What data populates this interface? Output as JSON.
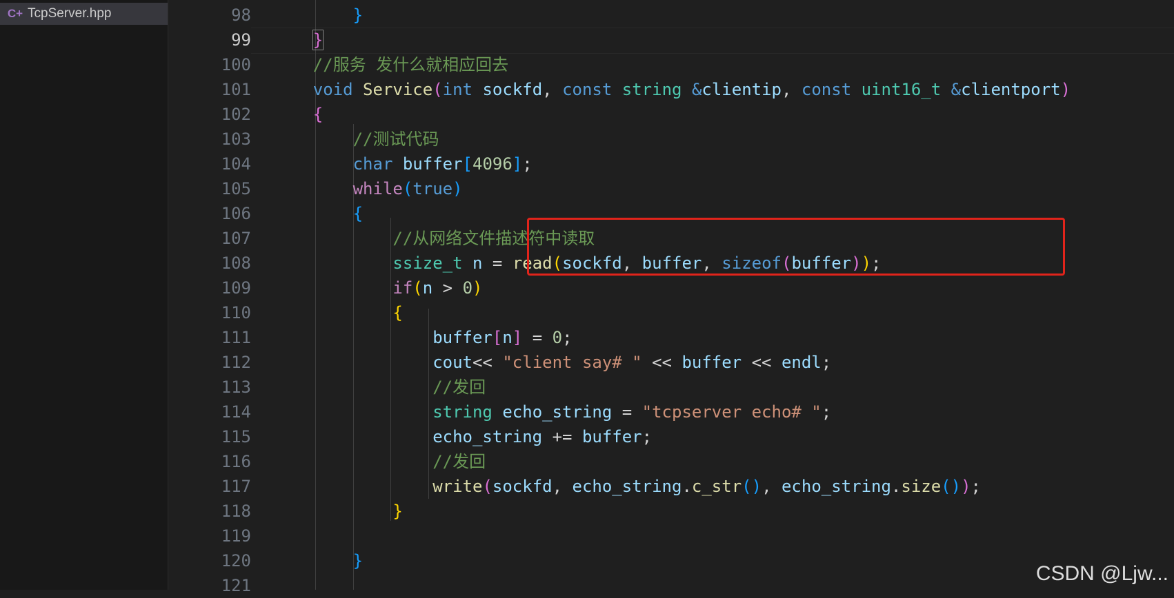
{
  "sidebar": {
    "file": {
      "name": "TcpServer.hpp",
      "icon": "cpp-header-icon",
      "icon_glyph": "C+"
    }
  },
  "editor": {
    "active_line": 99,
    "line_numbers": [
      "98",
      "99",
      "100",
      "101",
      "102",
      "103",
      "104",
      "105",
      "106",
      "107",
      "108",
      "109",
      "110",
      "111",
      "112",
      "113",
      "114",
      "115",
      "116",
      "117",
      "118",
      "119",
      "120",
      "121"
    ],
    "highlight_lines": [
      107,
      108
    ],
    "highlight_color": "#e0241b",
    "lines": [
      {
        "no": "98",
        "tokens": [
          {
            "t": "        ",
            "c": ""
          },
          {
            "t": "}",
            "c": "b3"
          }
        ]
      },
      {
        "no": "99",
        "tokens": [
          {
            "t": "    ",
            "c": ""
          },
          {
            "t": "}",
            "c": "b2"
          }
        ]
      },
      {
        "no": "100",
        "tokens": [
          {
            "t": "    ",
            "c": ""
          },
          {
            "t": "//服务 发什么就相应回去",
            "c": "cm"
          }
        ]
      },
      {
        "no": "101",
        "tokens": [
          {
            "t": "    ",
            "c": ""
          },
          {
            "t": "void",
            "c": "kw"
          },
          {
            "t": " ",
            "c": ""
          },
          {
            "t": "Service",
            "c": "fn"
          },
          {
            "t": "(",
            "c": "b2"
          },
          {
            "t": "int",
            "c": "kw"
          },
          {
            "t": " ",
            "c": ""
          },
          {
            "t": "sockfd",
            "c": "va"
          },
          {
            "t": ", ",
            "c": "op"
          },
          {
            "t": "const",
            "c": "kw"
          },
          {
            "t": " ",
            "c": ""
          },
          {
            "t": "string",
            "c": "ty"
          },
          {
            "t": " ",
            "c": ""
          },
          {
            "t": "&",
            "c": "kw"
          },
          {
            "t": "clientip",
            "c": "va"
          },
          {
            "t": ", ",
            "c": "op"
          },
          {
            "t": "const",
            "c": "kw"
          },
          {
            "t": " ",
            "c": ""
          },
          {
            "t": "uint16_t",
            "c": "ty"
          },
          {
            "t": " ",
            "c": ""
          },
          {
            "t": "&",
            "c": "kw"
          },
          {
            "t": "clientport",
            "c": "va"
          },
          {
            "t": ")",
            "c": "b2"
          }
        ]
      },
      {
        "no": "102",
        "tokens": [
          {
            "t": "    ",
            "c": ""
          },
          {
            "t": "{",
            "c": "b2"
          }
        ]
      },
      {
        "no": "103",
        "tokens": [
          {
            "t": "        ",
            "c": ""
          },
          {
            "t": "//测试代码",
            "c": "cm"
          }
        ]
      },
      {
        "no": "104",
        "tokens": [
          {
            "t": "        ",
            "c": ""
          },
          {
            "t": "char",
            "c": "kw"
          },
          {
            "t": " ",
            "c": ""
          },
          {
            "t": "buffer",
            "c": "va"
          },
          {
            "t": "[",
            "c": "b3"
          },
          {
            "t": "4096",
            "c": "nu"
          },
          {
            "t": "]",
            "c": "b3"
          },
          {
            "t": ";",
            "c": "op"
          }
        ]
      },
      {
        "no": "105",
        "tokens": [
          {
            "t": "        ",
            "c": ""
          },
          {
            "t": "while",
            "c": "ctl"
          },
          {
            "t": "(",
            "c": "b3"
          },
          {
            "t": "true",
            "c": "kw"
          },
          {
            "t": ")",
            "c": "b3"
          }
        ]
      },
      {
        "no": "106",
        "tokens": [
          {
            "t": "        ",
            "c": ""
          },
          {
            "t": "{",
            "c": "b3"
          }
        ]
      },
      {
        "no": "107",
        "tokens": [
          {
            "t": "            ",
            "c": ""
          },
          {
            "t": "//从网络文件描述符中读取",
            "c": "cm"
          }
        ]
      },
      {
        "no": "108",
        "tokens": [
          {
            "t": "            ",
            "c": ""
          },
          {
            "t": "ssize_t",
            "c": "ty"
          },
          {
            "t": " ",
            "c": ""
          },
          {
            "t": "n",
            "c": "va"
          },
          {
            "t": " = ",
            "c": "op"
          },
          {
            "t": "read",
            "c": "fn"
          },
          {
            "t": "(",
            "c": "b1"
          },
          {
            "t": "sockfd",
            "c": "va"
          },
          {
            "t": ", ",
            "c": "op"
          },
          {
            "t": "buffer",
            "c": "va"
          },
          {
            "t": ", ",
            "c": "op"
          },
          {
            "t": "sizeof",
            "c": "kw"
          },
          {
            "t": "(",
            "c": "b2"
          },
          {
            "t": "buffer",
            "c": "va"
          },
          {
            "t": ")",
            "c": "b2"
          },
          {
            "t": ")",
            "c": "b1"
          },
          {
            "t": ";",
            "c": "op"
          }
        ]
      },
      {
        "no": "109",
        "tokens": [
          {
            "t": "            ",
            "c": ""
          },
          {
            "t": "if",
            "c": "ctl"
          },
          {
            "t": "(",
            "c": "b1"
          },
          {
            "t": "n",
            "c": "va"
          },
          {
            "t": " > ",
            "c": "op"
          },
          {
            "t": "0",
            "c": "nu"
          },
          {
            "t": ")",
            "c": "b1"
          }
        ]
      },
      {
        "no": "110",
        "tokens": [
          {
            "t": "            ",
            "c": ""
          },
          {
            "t": "{",
            "c": "b1"
          }
        ]
      },
      {
        "no": "111",
        "tokens": [
          {
            "t": "                ",
            "c": ""
          },
          {
            "t": "buffer",
            "c": "va"
          },
          {
            "t": "[",
            "c": "b2"
          },
          {
            "t": "n",
            "c": "va"
          },
          {
            "t": "]",
            "c": "b2"
          },
          {
            "t": " = ",
            "c": "op"
          },
          {
            "t": "0",
            "c": "nu"
          },
          {
            "t": ";",
            "c": "op"
          }
        ]
      },
      {
        "no": "112",
        "tokens": [
          {
            "t": "                ",
            "c": ""
          },
          {
            "t": "cout",
            "c": "va"
          },
          {
            "t": "<< ",
            "c": "op"
          },
          {
            "t": "\"client say# \"",
            "c": "st"
          },
          {
            "t": " << ",
            "c": "op"
          },
          {
            "t": "buffer",
            "c": "va"
          },
          {
            "t": " << ",
            "c": "op"
          },
          {
            "t": "endl",
            "c": "va"
          },
          {
            "t": ";",
            "c": "op"
          }
        ]
      },
      {
        "no": "113",
        "tokens": [
          {
            "t": "                ",
            "c": ""
          },
          {
            "t": "//发回",
            "c": "cm"
          }
        ]
      },
      {
        "no": "114",
        "tokens": [
          {
            "t": "                ",
            "c": ""
          },
          {
            "t": "string",
            "c": "ty"
          },
          {
            "t": " ",
            "c": ""
          },
          {
            "t": "echo_string",
            "c": "va"
          },
          {
            "t": " = ",
            "c": "op"
          },
          {
            "t": "\"tcpserver echo# \"",
            "c": "st"
          },
          {
            "t": ";",
            "c": "op"
          }
        ]
      },
      {
        "no": "115",
        "tokens": [
          {
            "t": "                ",
            "c": ""
          },
          {
            "t": "echo_string",
            "c": "va"
          },
          {
            "t": " += ",
            "c": "op"
          },
          {
            "t": "buffer",
            "c": "va"
          },
          {
            "t": ";",
            "c": "op"
          }
        ]
      },
      {
        "no": "116",
        "tokens": [
          {
            "t": "                ",
            "c": ""
          },
          {
            "t": "//发回",
            "c": "cm"
          }
        ]
      },
      {
        "no": "117",
        "tokens": [
          {
            "t": "                ",
            "c": ""
          },
          {
            "t": "write",
            "c": "fn"
          },
          {
            "t": "(",
            "c": "b2"
          },
          {
            "t": "sockfd",
            "c": "va"
          },
          {
            "t": ", ",
            "c": "op"
          },
          {
            "t": "echo_string",
            "c": "va"
          },
          {
            "t": ".",
            "c": "op"
          },
          {
            "t": "c_str",
            "c": "fn"
          },
          {
            "t": "()",
            "c": "b3"
          },
          {
            "t": ", ",
            "c": "op"
          },
          {
            "t": "echo_string",
            "c": "va"
          },
          {
            "t": ".",
            "c": "op"
          },
          {
            "t": "size",
            "c": "fn"
          },
          {
            "t": "()",
            "c": "b3"
          },
          {
            "t": ")",
            "c": "b2"
          },
          {
            "t": ";",
            "c": "op"
          }
        ]
      },
      {
        "no": "118",
        "tokens": [
          {
            "t": "            ",
            "c": ""
          },
          {
            "t": "}",
            "c": "b1"
          }
        ]
      },
      {
        "no": "119",
        "tokens": []
      },
      {
        "no": "120",
        "tokens": [
          {
            "t": "        ",
            "c": ""
          },
          {
            "t": "}",
            "c": "b3"
          }
        ]
      },
      {
        "no": "121",
        "tokens": []
      }
    ]
  },
  "watermark": "CSDN @Ljw..."
}
